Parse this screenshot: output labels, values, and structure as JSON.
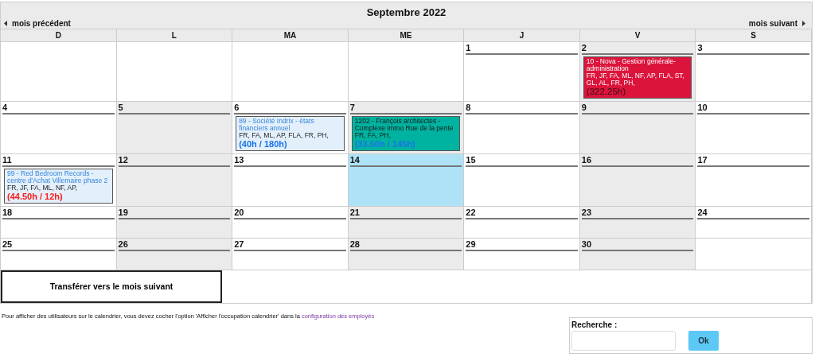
{
  "header": {
    "title": "Septembre 2022",
    "prev": "mois précédent",
    "next": "mois suivant"
  },
  "weekdays": [
    "D",
    "L",
    "MA",
    "ME",
    "J",
    "V",
    "S"
  ],
  "weeks": [
    [
      {
        "kind": "blank"
      },
      {
        "kind": "blank"
      },
      {
        "kind": "blank"
      },
      {
        "kind": "blank"
      },
      {
        "day": "1",
        "shaded": false,
        "today": false
      },
      {
        "day": "2",
        "shaded": true,
        "today": false,
        "events": [
          {
            "title": "10 - Nova - Gestion générale-administration",
            "users": "FR, JF, FA, ML, NF, AP, FLA, ST, GL, AL, FR, PH,",
            "hours": "(322.25h)",
            "color": "#dc143c",
            "kind": "solid",
            "over_budget": false
          }
        ]
      },
      {
        "day": "3",
        "shaded": false,
        "today": false
      }
    ],
    [
      {
        "day": "4",
        "shaded": false,
        "today": false
      },
      {
        "day": "5",
        "shaded": true,
        "today": false
      },
      {
        "day": "6",
        "shaded": false,
        "today": false,
        "events": [
          {
            "title": "89 - Société Indrix - états financiers annuel",
            "users": "FR, FA, ML, AP, FLA, FR, PH,",
            "hours": "(40h / 180h)",
            "color": "#e3f0fc",
            "kind": "light",
            "over_budget": false
          }
        ]
      },
      {
        "day": "7",
        "shaded": true,
        "today": false,
        "events": [
          {
            "title": "1202 - François architectes - Complexe immo Rue de la pente",
            "users": "FR, FA, PH,",
            "hours": "(33.50h / 145h)",
            "color": "#00b3a0",
            "kind": "accent",
            "over_budget": false
          }
        ]
      },
      {
        "day": "8",
        "shaded": false,
        "today": false
      },
      {
        "day": "9",
        "shaded": true,
        "today": false
      },
      {
        "day": "10",
        "shaded": false,
        "today": false
      }
    ],
    [
      {
        "day": "11",
        "shaded": false,
        "today": false,
        "events": [
          {
            "title": "99 - Red Bedroom Records - centre d'Achat Villemaire phase 2",
            "users": "FR, JF, FA, ML, NF, AP,",
            "hours": "(44.50h / 12h)",
            "color": "#e3f0fc",
            "kind": "light",
            "over_budget": true
          }
        ]
      },
      {
        "day": "12",
        "shaded": true,
        "today": false
      },
      {
        "day": "13",
        "shaded": false,
        "today": false
      },
      {
        "day": "14",
        "shaded": true,
        "today": true
      },
      {
        "day": "15",
        "shaded": false,
        "today": false
      },
      {
        "day": "16",
        "shaded": true,
        "today": false
      },
      {
        "day": "17",
        "shaded": false,
        "today": false
      }
    ],
    [
      {
        "day": "18",
        "shaded": false,
        "today": false
      },
      {
        "day": "19",
        "shaded": true,
        "today": false
      },
      {
        "day": "20",
        "shaded": false,
        "today": false
      },
      {
        "day": "21",
        "shaded": true,
        "today": false
      },
      {
        "day": "22",
        "shaded": false,
        "today": false
      },
      {
        "day": "23",
        "shaded": true,
        "today": false
      },
      {
        "day": "24",
        "shaded": false,
        "today": false
      }
    ],
    [
      {
        "day": "25",
        "shaded": false,
        "today": false
      },
      {
        "day": "26",
        "shaded": true,
        "today": false
      },
      {
        "day": "27",
        "shaded": false,
        "today": false
      },
      {
        "day": "28",
        "shaded": true,
        "today": false
      },
      {
        "day": "29",
        "shaded": false,
        "today": false
      },
      {
        "day": "30",
        "shaded": true,
        "today": false
      },
      {
        "kind": "blank"
      }
    ]
  ],
  "transfer_button": "Transférer vers le mois suivant",
  "note": {
    "text": "Pour afficher des utilisateurs sur le calendrier, vous devez cocher l'option 'Afficher l'occupation calendrier' dans la",
    "link": "configuration des employés"
  },
  "search": {
    "label": "Recherche :",
    "button": "Ok"
  }
}
